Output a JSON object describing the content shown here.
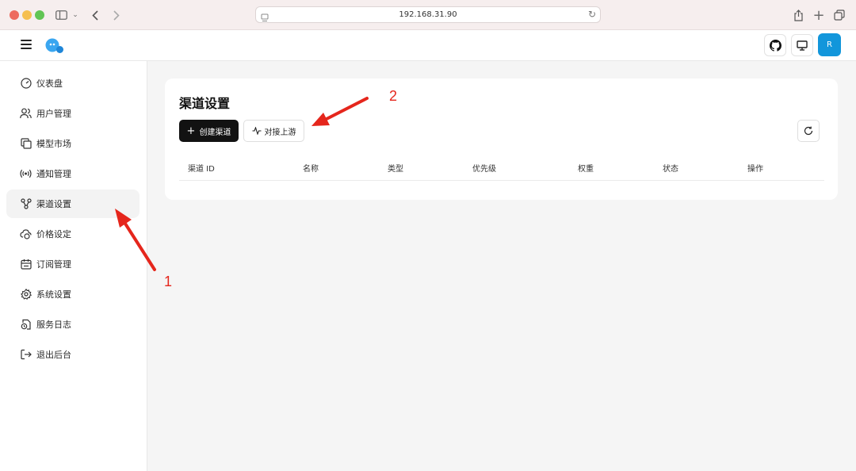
{
  "browser": {
    "url": "192.168.31.90"
  },
  "sidebar": {
    "items": [
      {
        "label": "仪表盘",
        "icon": "gauge-icon"
      },
      {
        "label": "用户管理",
        "icon": "users-icon"
      },
      {
        "label": "模型市场",
        "icon": "copy-icon"
      },
      {
        "label": "通知管理",
        "icon": "broadcast-icon"
      },
      {
        "label": "渠道设置",
        "icon": "workflow-icon",
        "active": true
      },
      {
        "label": "价格设定",
        "icon": "cloud-money-icon"
      },
      {
        "label": "订阅管理",
        "icon": "calendar-icon"
      },
      {
        "label": "系统设置",
        "icon": "gear-icon"
      },
      {
        "label": "服务日志",
        "icon": "file-clock-icon"
      },
      {
        "label": "退出后台",
        "icon": "logout-icon"
      }
    ]
  },
  "header": {
    "avatar_letter": "R"
  },
  "main": {
    "title": "渠道设置",
    "create_button": "创建渠道",
    "connect_button": "对接上游",
    "columns": [
      "渠道 ID",
      "名称",
      "类型",
      "优先级",
      "权重",
      "状态",
      "操作"
    ]
  },
  "annotations": {
    "label_1": "1",
    "label_2": "2"
  },
  "colors": {
    "accent": "#1296db",
    "primary_button": "#121212",
    "annotation": "#e5261c"
  }
}
